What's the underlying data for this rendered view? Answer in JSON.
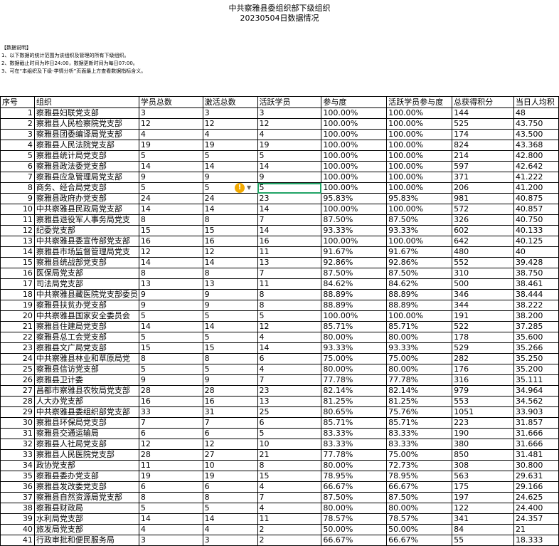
{
  "header": {
    "title": "中共察雅县委组织部下级组织",
    "subtitle": "20230504日数据情况"
  },
  "notes": [
    "【数据说明】",
    "1、以下数据的统计范围为该组织及管理的所有下级组织。",
    "2、数据截止时间为昨日24:00，数据更新时间为每日07:00。",
    "3、可在“本组织及下级-学情分析”页面最上方查看数据指标含义。"
  ],
  "table": {
    "columns": [
      "序号",
      "组织",
      "学员总数",
      "激活总数",
      "活跃学员",
      "参与度",
      "活跃学员参与度",
      "总获得积分",
      "当日人均积"
    ],
    "rows": [
      [
        "1",
        "察雅县妇联党支部",
        "3",
        "3",
        "3",
        "100.00%",
        "100.00%",
        "144",
        "48"
      ],
      [
        "2",
        "察雅县人民检察院党支部",
        "12",
        "12",
        "12",
        "100.00%",
        "100.00%",
        "525",
        "43.750"
      ],
      [
        "3",
        "察雅县团委编译局党支部",
        "4",
        "4",
        "4",
        "100.00%",
        "100.00%",
        "174",
        "43.500"
      ],
      [
        "4",
        "察雅县人民法院党支部",
        "19",
        "19",
        "19",
        "100.00%",
        "100.00%",
        "824",
        "43.368"
      ],
      [
        "5",
        "察雅县统计局党支部",
        "5",
        "5",
        "5",
        "100.00%",
        "100.00%",
        "214",
        "42.800"
      ],
      [
        "6",
        "察雅县政法委党支部",
        "14",
        "14",
        "14",
        "100.00%",
        "100.00%",
        "597",
        "42.642"
      ],
      [
        "7",
        "察雅县应急管理局党支部",
        "9",
        "9",
        "9",
        "100.00%",
        "100.00%",
        "371",
        "41.222"
      ],
      [
        "8",
        "商务、经合局党支部",
        "5",
        "5",
        "5",
        "100.00%",
        "100.00%",
        "206",
        "41.200"
      ],
      [
        "9",
        "察雅县政府办党支部",
        "24",
        "24",
        "23",
        "95.83%",
        "95.83%",
        "981",
        "40.875"
      ],
      [
        "10",
        "中共察雅县民政局党支部",
        "14",
        "14",
        "14",
        "100.00%",
        "100.00%",
        "572",
        "40.857"
      ],
      [
        "11",
        "察雅县退役军人事务局党支",
        "8",
        "8",
        "7",
        "87.50%",
        "87.50%",
        "326",
        "40.750"
      ],
      [
        "12",
        "纪委党支部",
        "15",
        "15",
        "14",
        "93.33%",
        "93.33%",
        "602",
        "40.133"
      ],
      [
        "13",
        "中共察雅县委宣传部党支部",
        "16",
        "16",
        "16",
        "100.00%",
        "100.00%",
        "642",
        "40.125"
      ],
      [
        "14",
        "察雅县市场监督管理局党支",
        "12",
        "12",
        "11",
        "91.67%",
        "91.67%",
        "480",
        "40"
      ],
      [
        "15",
        "察雅县统战部党支部",
        "14",
        "14",
        "13",
        "92.86%",
        "92.86%",
        "552",
        "39.428"
      ],
      [
        "16",
        "医保局党支部",
        "8",
        "8",
        "7",
        "87.50%",
        "87.50%",
        "310",
        "38.750"
      ],
      [
        "17",
        "司法局党支部",
        "13",
        "13",
        "11",
        "84.62%",
        "84.62%",
        "500",
        "38.461"
      ],
      [
        "18",
        "中共察雅县藏医院党支部委员",
        "9",
        "9",
        "8",
        "88.89%",
        "88.89%",
        "346",
        "38.444"
      ],
      [
        "19",
        "察雅县扶贫办党支部",
        "9",
        "9",
        "8",
        "88.89%",
        "88.89%",
        "344",
        "38.222"
      ],
      [
        "20",
        "中共察雅县国家安全委员会",
        "5",
        "5",
        "5",
        "100.00%",
        "100.00%",
        "191",
        "38.200"
      ],
      [
        "21",
        "察雅县住建局党支部",
        "14",
        "14",
        "12",
        "85.71%",
        "85.71%",
        "522",
        "37.285"
      ],
      [
        "22",
        "察雅县总工会党支部",
        "5",
        "5",
        "4",
        "80.00%",
        "80.00%",
        "178",
        "35.600"
      ],
      [
        "23",
        "察雅县文广局党支部",
        "15",
        "15",
        "14",
        "93.33%",
        "93.33%",
        "529",
        "35.266"
      ],
      [
        "24",
        "中共察雅县林业和草原局党",
        "8",
        "8",
        "6",
        "75.00%",
        "75.00%",
        "282",
        "35.250"
      ],
      [
        "25",
        "察雅县信访党支部",
        "5",
        "5",
        "4",
        "80.00%",
        "80.00%",
        "176",
        "35.200"
      ],
      [
        "26",
        "察雅县卫计委",
        "9",
        "9",
        "7",
        "77.78%",
        "77.78%",
        "316",
        "35.111"
      ],
      [
        "27",
        "昌都市察雅县农牧局党支部",
        "28",
        "28",
        "23",
        "82.14%",
        "82.14%",
        "979",
        "34.964"
      ],
      [
        "28",
        "人大办党支部",
        "16",
        "16",
        "13",
        "81.25%",
        "81.25%",
        "553",
        "34.562"
      ],
      [
        "29",
        "中共察雅县委组织部党支部",
        "33",
        "31",
        "25",
        "80.65%",
        "75.76%",
        "1051",
        "33.903"
      ],
      [
        "30",
        "察雅县环保局党支部",
        "7",
        "7",
        "6",
        "85.71%",
        "85.71%",
        "223",
        "31.857"
      ],
      [
        "31",
        "察雅县交通运输局",
        "6",
        "6",
        "5",
        "83.33%",
        "83.33%",
        "190",
        "31.666"
      ],
      [
        "32",
        "察雅县人社局党支部",
        "12",
        "12",
        "10",
        "83.33%",
        "83.33%",
        "380",
        "31.666"
      ],
      [
        "33",
        "察雅县人民医院党支部",
        "28",
        "27",
        "21",
        "77.78%",
        "75.00%",
        "850",
        "31.481"
      ],
      [
        "34",
        "政协党支部",
        "11",
        "10",
        "8",
        "80.00%",
        "72.73%",
        "308",
        "30.800"
      ],
      [
        "35",
        "察雅县委办党支部",
        "19",
        "19",
        "15",
        "78.95%",
        "78.95%",
        "563",
        "29.631"
      ],
      [
        "36",
        "察雅县发改委党支部",
        "6",
        "6",
        "4",
        "66.67%",
        "66.67%",
        "175",
        "29.166"
      ],
      [
        "37",
        "察雅县自然资源局党支部",
        "8",
        "8",
        "7",
        "87.50%",
        "87.50%",
        "197",
        "24.625"
      ],
      [
        "38",
        "察雅县财政局",
        "5",
        "5",
        "4",
        "80.00%",
        "80.00%",
        "122",
        "24.400"
      ],
      [
        "39",
        "水利局党支部",
        "14",
        "14",
        "11",
        "78.57%",
        "78.57%",
        "341",
        "24.357"
      ],
      [
        "40",
        "旅发局党支部",
        "4",
        "4",
        "2",
        "50.00%",
        "50.00%",
        "84",
        "21"
      ],
      [
        "41",
        "行政审批和便民服务局",
        "3",
        "3",
        "2",
        "66.67%",
        "66.67%",
        "55",
        "18.333"
      ]
    ]
  },
  "selected_cell": {
    "row": 8,
    "column": "活跃学员"
  },
  "icons": {
    "warning": "warning-icon",
    "dropdown": "chevron-down-icon"
  },
  "colors": {
    "selection": "#21a366",
    "warning": "#f2a900"
  }
}
